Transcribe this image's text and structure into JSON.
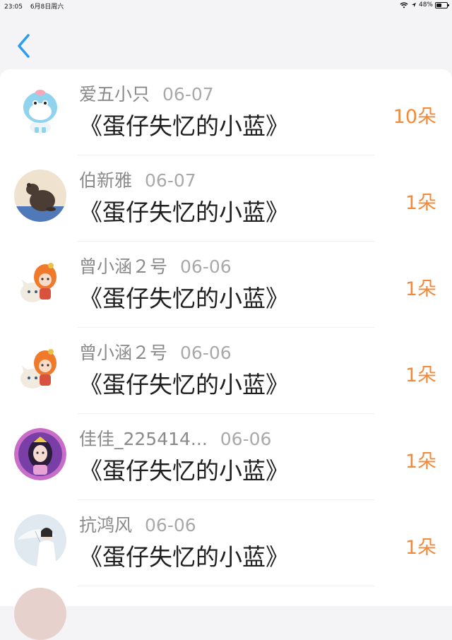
{
  "status_bar": {
    "time": "23:05",
    "date": "6月8日周六",
    "battery": "48%",
    "battery_level": 0.48
  },
  "nav": {
    "back_icon": "chevron-left-icon",
    "accent_color": "#2d9cf0"
  },
  "list": {
    "count_color": "#f28a3a",
    "rows": [
      {
        "name": "爱五小只",
        "date": "06-07",
        "title": "《蛋仔失忆的小蓝》",
        "count": "10朵",
        "avatar": "cartoon-blue-mascot-avatar"
      },
      {
        "name": "伯新雅",
        "date": "06-07",
        "title": "《蛋仔失忆的小蓝》",
        "count": "1朵",
        "avatar": "bear-photo-avatar"
      },
      {
        "name": "曾小涵２号",
        "date": "06-06",
        "title": "《蛋仔失忆的小蓝》",
        "count": "1朵",
        "avatar": "anime-girl-cat-avatar"
      },
      {
        "name": "曾小涵２号",
        "date": "06-06",
        "title": "《蛋仔失忆的小蓝》",
        "count": "1朵",
        "avatar": "anime-girl-cat-avatar"
      },
      {
        "name": "佳佳_225414...",
        "date": "06-06",
        "title": "《蛋仔失忆的小蓝》",
        "count": "1朵",
        "avatar": "princess-doll-avatar"
      },
      {
        "name": "抗鸿风",
        "date": "06-06",
        "title": "《蛋仔失忆的小蓝》",
        "count": "1朵",
        "avatar": "girl-umbrella-photo-avatar"
      }
    ]
  }
}
